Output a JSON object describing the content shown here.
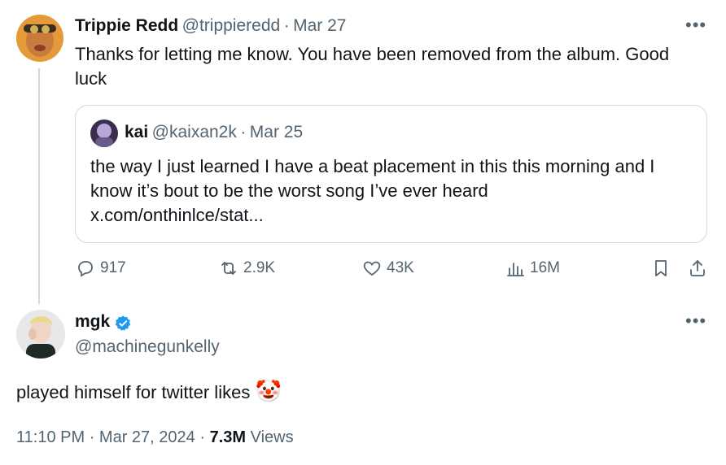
{
  "tweet": {
    "author_name": "Trippie Redd",
    "author_handle": "@trippieredd",
    "date": "Mar 27",
    "text_line1": "Thanks for letting me know. You have been removed from the album. Good",
    "text_line2": "luck",
    "quote": {
      "author_name": "kai",
      "author_handle": "@kaixan2k",
      "date": "Mar 25",
      "line1": "the way I just learned I have a beat placement in this this morning and I",
      "line2": "know it’s bout to be the worst song I’ve ever heard",
      "line3": "x.com/onthinlce/stat..."
    },
    "metrics": {
      "replies": "917",
      "reposts": "2.9K",
      "likes": "43K",
      "views": "16M"
    }
  },
  "reply": {
    "author_name": "mgk",
    "author_handle": "@machinegunkelly",
    "text": "played himself for twitter likes",
    "emoji": "🤡",
    "time": "11:10 PM",
    "date": "Mar 27, 2024",
    "views_count": "7.3M",
    "views_label": "Views"
  },
  "separator": "·",
  "more_icon": "•••",
  "colors": {
    "verified": "#1d9bf0",
    "muted": "#536471",
    "border": "#cfd9de"
  }
}
